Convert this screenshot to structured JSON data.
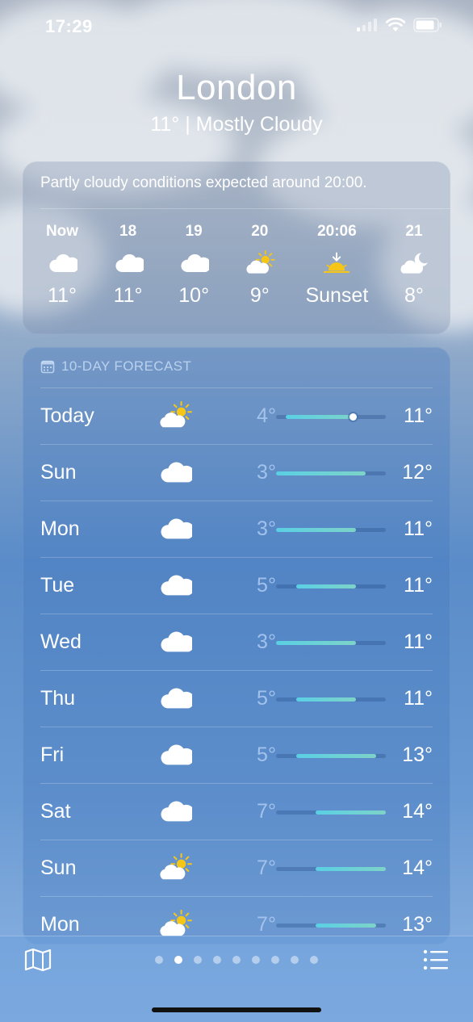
{
  "status": {
    "time": "17:29"
  },
  "header": {
    "city": "London",
    "summary": "11°  |  Mostly Cloudy"
  },
  "hourly": {
    "alert": "Partly cloudy conditions expected around 20:00.",
    "items": [
      {
        "time": "Now",
        "icon": "cloud-icon",
        "temp": "11°"
      },
      {
        "time": "18",
        "icon": "cloud-icon",
        "temp": "11°"
      },
      {
        "time": "19",
        "icon": "cloud-icon",
        "temp": "10°"
      },
      {
        "time": "20",
        "icon": "partly-sunny-icon",
        "temp": "9°"
      },
      {
        "time": "20:06",
        "icon": "sunset-icon",
        "temp": "Sunset"
      },
      {
        "time": "21",
        "icon": "partly-cloudy-night-icon",
        "temp": "8°"
      }
    ]
  },
  "forecast": {
    "title": "10-DAY FORECAST",
    "scale": {
      "min": 3,
      "max": 14
    },
    "days": [
      {
        "day": "Today",
        "icon": "partly-sunny-icon",
        "low": "4°",
        "high": "11°",
        "lowv": 4,
        "highv": 11,
        "current": 11
      },
      {
        "day": "Sun",
        "icon": "cloud-icon",
        "low": "3°",
        "high": "12°",
        "lowv": 3,
        "highv": 12
      },
      {
        "day": "Mon",
        "icon": "cloud-icon",
        "low": "3°",
        "high": "11°",
        "lowv": 3,
        "highv": 11
      },
      {
        "day": "Tue",
        "icon": "cloud-icon",
        "low": "5°",
        "high": "11°",
        "lowv": 5,
        "highv": 11
      },
      {
        "day": "Wed",
        "icon": "cloud-icon",
        "low": "3°",
        "high": "11°",
        "lowv": 3,
        "highv": 11
      },
      {
        "day": "Thu",
        "icon": "cloud-icon",
        "low": "5°",
        "high": "11°",
        "lowv": 5,
        "highv": 11
      },
      {
        "day": "Fri",
        "icon": "cloud-icon",
        "low": "5°",
        "high": "13°",
        "lowv": 5,
        "highv": 13
      },
      {
        "day": "Sat",
        "icon": "cloud-icon",
        "low": "7°",
        "high": "14°",
        "lowv": 7,
        "highv": 14
      },
      {
        "day": "Sun",
        "icon": "partly-sunny-icon",
        "low": "7°",
        "high": "14°",
        "lowv": 7,
        "highv": 14
      },
      {
        "day": "Mon",
        "icon": "partly-sunny-icon",
        "low": "7°",
        "high": "13°",
        "lowv": 7,
        "highv": 13
      }
    ]
  },
  "pager": {
    "count": 9,
    "active": 1
  },
  "colors": {
    "bar_start": "#5ad0e4",
    "bar_end": "#7dd3c8",
    "sun": "#f5c518"
  }
}
